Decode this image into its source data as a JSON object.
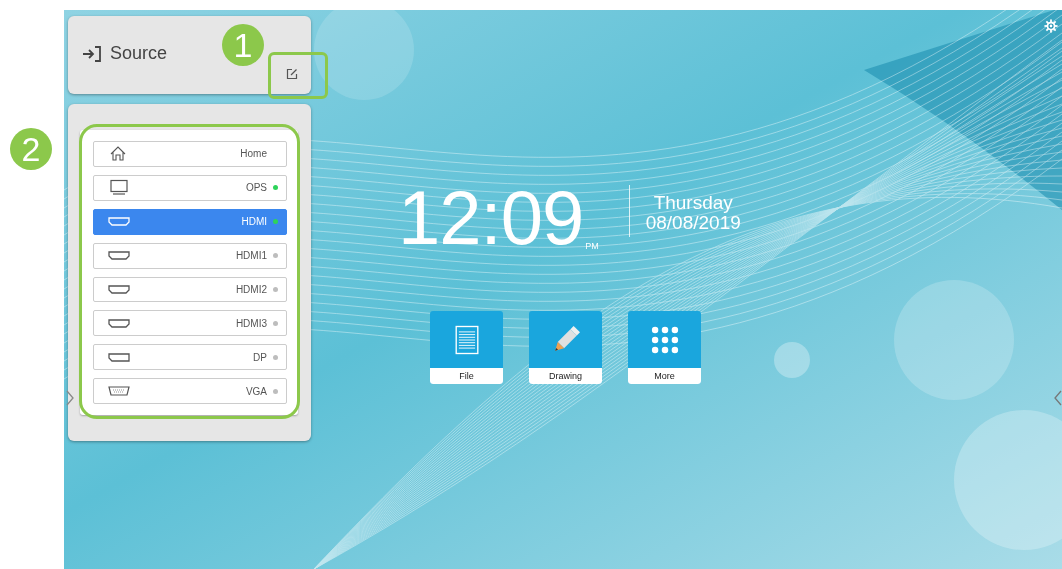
{
  "annotations": [
    {
      "label": "1"
    },
    {
      "label": "2"
    }
  ],
  "source_panel": {
    "title": "Source"
  },
  "sources": [
    {
      "label": "Home",
      "kind": "home",
      "selected": false
    },
    {
      "label": "OPS",
      "kind": "monitor",
      "selected": false,
      "color": "#2ed35a"
    },
    {
      "label": "HDMI",
      "kind": "hdmi",
      "selected": true,
      "color": "#2ed35a"
    },
    {
      "label": "HDMI1",
      "kind": "hdmi",
      "selected": false,
      "color": "#bdbdbd"
    },
    {
      "label": "HDMI2",
      "kind": "hdmi",
      "selected": false,
      "color": "#bdbdbd"
    },
    {
      "label": "HDMI3",
      "kind": "hdmi",
      "selected": false,
      "color": "#bdbdbd"
    },
    {
      "label": "DP",
      "kind": "displayport",
      "selected": false,
      "color": "#bdbdbd"
    },
    {
      "label": "VGA",
      "kind": "vga",
      "selected": false,
      "color": "#bdbdbd"
    }
  ],
  "clock": {
    "time": "12:09",
    "meridiem": "PM",
    "day": "Thursday",
    "date": "08/08/2019"
  },
  "apps": [
    {
      "label": "File",
      "kind": "file"
    },
    {
      "label": "Drawing",
      "kind": "drawing"
    },
    {
      "label": "More",
      "kind": "more"
    }
  ]
}
